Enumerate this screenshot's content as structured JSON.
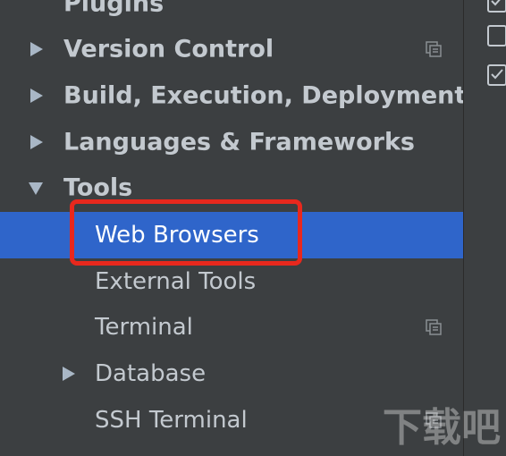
{
  "settings_tree": {
    "plugins": "Plugins",
    "version_control": "Version Control",
    "build": "Build, Execution, Deployment",
    "languages": "Languages & Frameworks",
    "tools": {
      "label": "Tools",
      "children": {
        "web_browsers": "Web Browsers",
        "external_tools": "External Tools",
        "terminal": "Terminal",
        "database": "Database",
        "ssh_terminal": "SSH Terminal"
      }
    }
  },
  "right_pane": {
    "checkboxes": [
      true,
      false,
      true
    ]
  },
  "colors": {
    "background": "#3c3f41",
    "selection": "#2f65ca",
    "highlight_border": "#e8281d",
    "text": "#c3c9cf"
  },
  "watermark": {
    "text": "下载吧",
    "url": "www.xiazaiba.com"
  }
}
